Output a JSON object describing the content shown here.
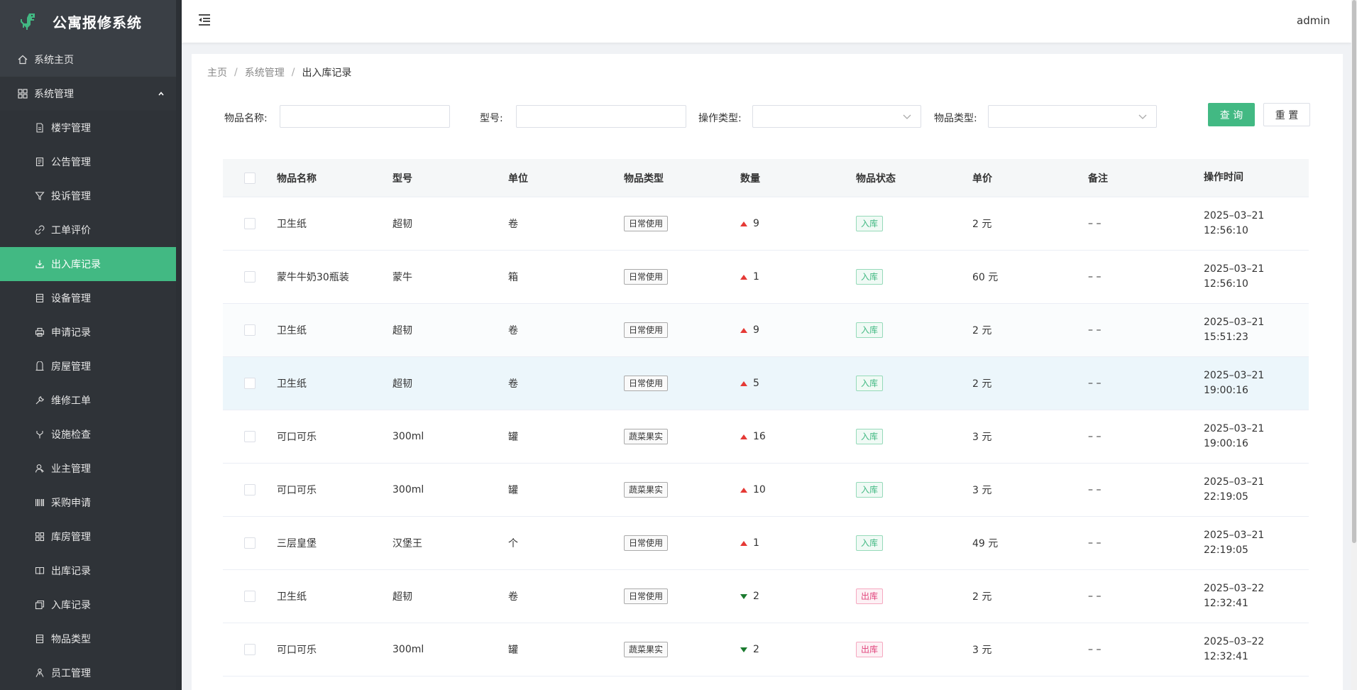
{
  "app": {
    "title": "公寓报修系统",
    "user": "admin"
  },
  "sidebar": {
    "home": "系统主页",
    "group": "系统管理",
    "items": [
      {
        "label": "楼宇管理",
        "icon": "document-icon"
      },
      {
        "label": "公告管理",
        "icon": "notice-icon"
      },
      {
        "label": "投诉管理",
        "icon": "filter-icon"
      },
      {
        "label": "工单评价",
        "icon": "link-icon"
      },
      {
        "label": "出入库记录",
        "icon": "download-icon",
        "active": true
      },
      {
        "label": "设备管理",
        "icon": "list-icon"
      },
      {
        "label": "申请记录",
        "icon": "printer-icon"
      },
      {
        "label": "房屋管理",
        "icon": "user-icon"
      },
      {
        "label": "维修工单",
        "icon": "wrench-icon"
      },
      {
        "label": "设施检查",
        "icon": "fork-icon"
      },
      {
        "label": "业主管理",
        "icon": "owner-icon"
      },
      {
        "label": "采购申请",
        "icon": "barcode-icon"
      },
      {
        "label": "库房管理",
        "icon": "grid-icon"
      },
      {
        "label": "出库记录",
        "icon": "book-icon"
      },
      {
        "label": "入库记录",
        "icon": "copy-icon"
      },
      {
        "label": "物品类型",
        "icon": "list-icon"
      },
      {
        "label": "员工管理",
        "icon": "staff-icon"
      }
    ]
  },
  "breadcrumb": [
    "主页",
    "系统管理",
    "出入库记录"
  ],
  "filters": {
    "name_label": "物品名称:",
    "model_label": "型号:",
    "op_label": "操作类型:",
    "type_label": "物品类型:",
    "query_button": "查 询",
    "reset_button": "重 置"
  },
  "table": {
    "headers": [
      "物品名称",
      "型号",
      "单位",
      "物品类型",
      "数量",
      "物品状态",
      "单价",
      "备注",
      "操作时间"
    ],
    "rows": [
      {
        "name": "卫生纸",
        "model": "超韧",
        "unit": "卷",
        "type": "日常使用",
        "dir": "up",
        "qty": "9",
        "status": "入库",
        "price": "2 元",
        "note": "– –",
        "date": "2025–03–21",
        "time": "12:56:10"
      },
      {
        "name": "蒙牛牛奶30瓶装",
        "model": "蒙牛",
        "unit": "箱",
        "type": "日常使用",
        "dir": "up",
        "qty": "1",
        "status": "入库",
        "price": "60 元",
        "note": "– –",
        "date": "2025–03–21",
        "time": "12:56:10"
      },
      {
        "name": "卫生纸",
        "model": "超韧",
        "unit": "卷",
        "type": "日常使用",
        "dir": "up",
        "qty": "9",
        "status": "入库",
        "price": "2 元",
        "note": "– –",
        "date": "2025–03–21",
        "time": "15:51:23"
      },
      {
        "name": "卫生纸",
        "model": "超韧",
        "unit": "卷",
        "type": "日常使用",
        "dir": "up",
        "qty": "5",
        "status": "入库",
        "price": "2 元",
        "note": "– –",
        "date": "2025–03–21",
        "time": "19:00:16"
      },
      {
        "name": "可口可乐",
        "model": "300ml",
        "unit": "罐",
        "type": "蔬菜果实",
        "dir": "up",
        "qty": "16",
        "status": "入库",
        "price": "3 元",
        "note": "– –",
        "date": "2025–03–21",
        "time": "19:00:16"
      },
      {
        "name": "可口可乐",
        "model": "300ml",
        "unit": "罐",
        "type": "蔬菜果实",
        "dir": "up",
        "qty": "10",
        "status": "入库",
        "price": "3 元",
        "note": "– –",
        "date": "2025–03–21",
        "time": "22:19:05"
      },
      {
        "name": "三层皇堡",
        "model": "汉堡王",
        "unit": "个",
        "type": "日常使用",
        "dir": "up",
        "qty": "1",
        "status": "入库",
        "price": "49 元",
        "note": "– –",
        "date": "2025–03–21",
        "time": "22:19:05"
      },
      {
        "name": "卫生纸",
        "model": "超韧",
        "unit": "卷",
        "type": "日常使用",
        "dir": "down",
        "qty": "2",
        "status": "出库",
        "price": "2 元",
        "note": "– –",
        "date": "2025–03–22",
        "time": "12:32:41"
      },
      {
        "name": "可口可乐",
        "model": "300ml",
        "unit": "罐",
        "type": "蔬菜果实",
        "dir": "down",
        "qty": "2",
        "status": "出库",
        "price": "3 元",
        "note": "– –",
        "date": "2025–03–22",
        "time": "12:32:41"
      }
    ]
  },
  "colors": {
    "accent": "#42b983",
    "sidebar_bg": "#3a3f45",
    "in": "#42b983",
    "out": "#e0447c",
    "up": "#e53935",
    "down": "#1b7a2f"
  }
}
